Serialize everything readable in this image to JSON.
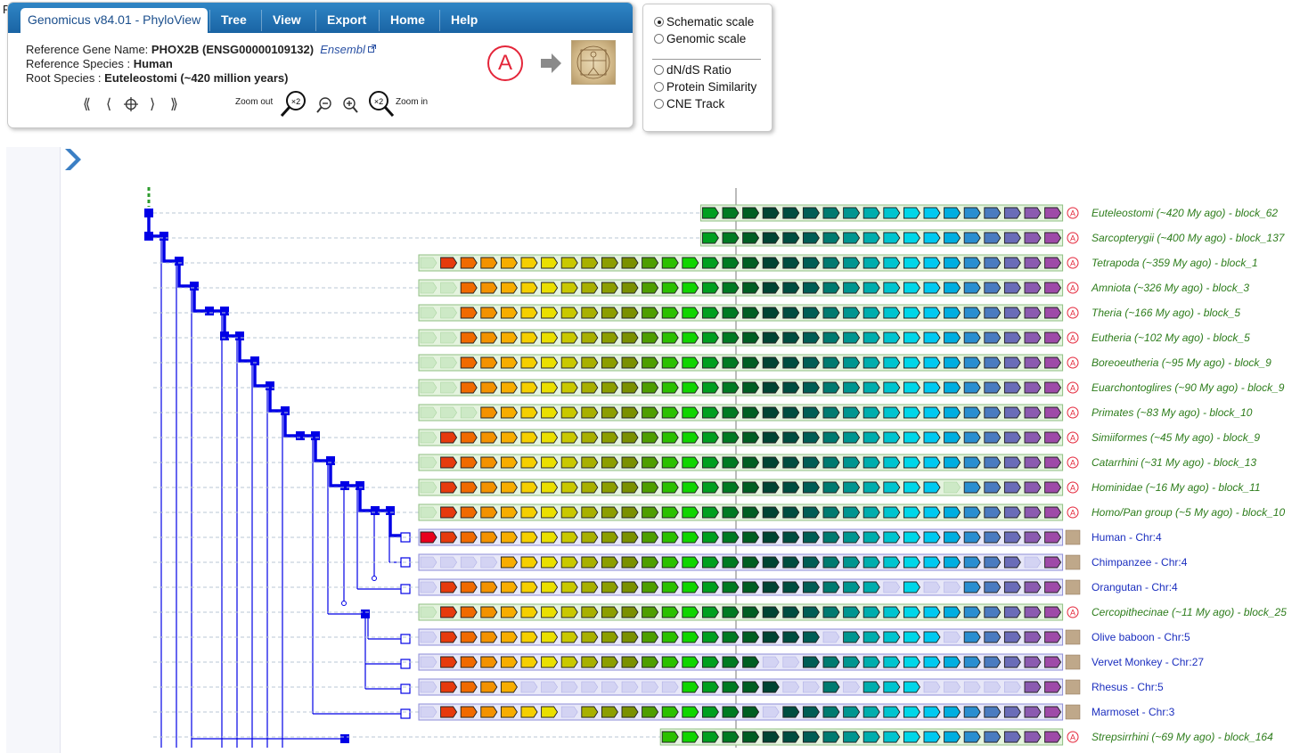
{
  "stray_char": "F",
  "header": {
    "app_title": "Genomicus v84.01 - PhyloView",
    "menu": [
      "Tree",
      "View",
      "Export",
      "Home",
      "Help"
    ],
    "gene_label": "Reference Gene Name:",
    "gene_value": "PHOX2B (ENSG00000109132)",
    "ensembl_link": "Ensembl",
    "species_label": "Reference Species :",
    "species_value": "Human",
    "root_label": "Root Species :",
    "root_value": "Euteleostomi (~420 million years)",
    "zoom_out_label": "Zoom out",
    "zoom_in_label": "Zoom in",
    "zoom_factor": "×2",
    "ancestor_badge": "A"
  },
  "options": {
    "scale": [
      {
        "label": "Schematic scale",
        "selected": true
      },
      {
        "label": "Genomic scale",
        "selected": false
      }
    ],
    "tracks": [
      {
        "label": "dN/dS Ratio",
        "selected": false
      },
      {
        "label": "Protein Similarity",
        "selected": false
      },
      {
        "label": "CNE Track",
        "selected": false
      }
    ]
  },
  "colors": {
    "tree": "#0000e6",
    "ancestral_text": "#2e7d1c",
    "extant_text": "#1c2fbf",
    "badge": "#e4263a",
    "root_dash": "#2e9c2e"
  },
  "rows": [
    {
      "label": "Euteleostomi (~420 My ago) - block_62",
      "type": "ancestral",
      "start": 14,
      "end": 31,
      "ghosts": []
    },
    {
      "label": "Sarcopterygii (~400 My ago) - block_137",
      "type": "ancestral",
      "start": 14,
      "end": 31,
      "ghosts": []
    },
    {
      "label": "Tetrapoda (~359 My ago) - block_1",
      "type": "ancestral",
      "start": 0,
      "end": 31,
      "ghosts": [
        0
      ]
    },
    {
      "label": "Amniota (~326 My ago) - block_3",
      "type": "ancestral",
      "start": 0,
      "end": 31,
      "ghosts": [
        0,
        1
      ]
    },
    {
      "label": "Theria (~166 My ago) - block_5",
      "type": "ancestral",
      "start": 0,
      "end": 31,
      "ghosts": [
        0,
        1
      ]
    },
    {
      "label": "Eutheria (~102 My ago) - block_5",
      "type": "ancestral",
      "start": 0,
      "end": 31,
      "ghosts": [
        0,
        1
      ]
    },
    {
      "label": "Boreoeutheria (~95 My ago) - block_9",
      "type": "ancestral",
      "start": 0,
      "end": 31,
      "ghosts": [
        0,
        1
      ]
    },
    {
      "label": "Euarchontoglires (~90 My ago) - block_9",
      "type": "ancestral",
      "start": 0,
      "end": 31,
      "ghosts": [
        0,
        1
      ]
    },
    {
      "label": "Primates (~83 My ago) - block_10",
      "type": "ancestral",
      "start": 0,
      "end": 31,
      "ghosts": [
        0,
        1,
        2
      ]
    },
    {
      "label": "Simiiformes (~45 My ago) - block_9",
      "type": "ancestral",
      "start": 0,
      "end": 31,
      "ghosts": [
        0
      ]
    },
    {
      "label": "Catarrhini (~31 My ago) - block_13",
      "type": "ancestral",
      "start": 0,
      "end": 31,
      "ghosts": [
        0
      ]
    },
    {
      "label": "Hominidae (~16 My ago) - block_11",
      "type": "ancestral",
      "start": 0,
      "end": 31,
      "ghosts": [
        0,
        26
      ]
    },
    {
      "label": "Homo/Pan group (~5 My ago) - block_10",
      "type": "ancestral",
      "start": 0,
      "end": 31,
      "ghosts": [
        0
      ]
    },
    {
      "label": "Human - Chr:4",
      "type": "extant",
      "start": 0,
      "end": 31,
      "ghosts": []
    },
    {
      "label": "Chimpanzee - Chr:4",
      "type": "extant",
      "start": 0,
      "end": 31,
      "ghosts": [
        0,
        1,
        2,
        3,
        30
      ]
    },
    {
      "label": "Orangutan - Chr:4",
      "type": "extant",
      "start": 0,
      "end": 31,
      "ghosts": [
        0,
        23,
        25,
        26
      ]
    },
    {
      "label": "Cercopithecinae (~11 My ago) - block_25",
      "type": "ancestral",
      "start": 0,
      "end": 31,
      "ghosts": [
        0
      ]
    },
    {
      "label": "Olive baboon - Chr:5",
      "type": "extant",
      "start": 0,
      "end": 31,
      "ghosts": [
        0,
        20,
        26
      ]
    },
    {
      "label": "Vervet Monkey - Chr:27",
      "type": "extant",
      "start": 0,
      "end": 31,
      "ghosts": [
        0,
        17,
        18
      ]
    },
    {
      "label": "Rhesus - Chr:5",
      "type": "extant",
      "start": 0,
      "end": 31,
      "ghosts": [
        0,
        5,
        6,
        7,
        8,
        9,
        10,
        11,
        12,
        18,
        19,
        21,
        25,
        26,
        27,
        28,
        29
      ]
    },
    {
      "label": "Marmoset - Chr:3",
      "type": "extant",
      "start": 0,
      "end": 31,
      "ghosts": [
        0,
        7,
        17
      ]
    },
    {
      "label": "Strepsirrhini (~69 My ago) - block_164",
      "type": "ancestral",
      "start": 12,
      "end": 31,
      "ghosts": []
    }
  ]
}
